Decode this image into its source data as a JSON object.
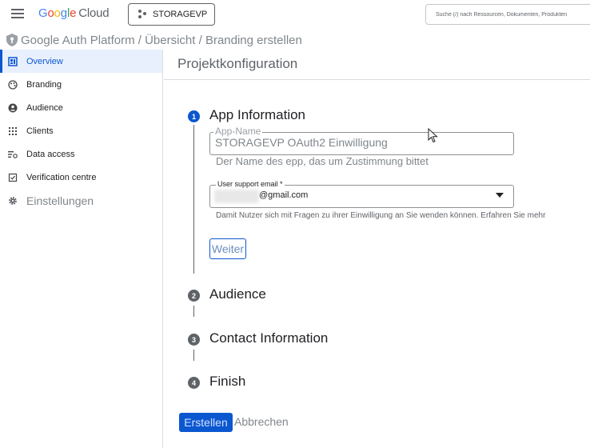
{
  "topbar": {
    "logo_letters": [
      "G",
      "o",
      "o",
      "g",
      "l",
      "e"
    ],
    "logo_suffix": "Cloud",
    "project_name": "STORAGEVP",
    "search_placeholder": "Suche (/) nach Ressourcen, Dokumenten, Produkten"
  },
  "breadcrumb": {
    "text": "Google Auth Platform / Übersicht / Branding erstellen"
  },
  "sidebar": {
    "items": [
      {
        "label": "Overview",
        "icon": "dashboard-icon",
        "active": true
      },
      {
        "label": "Branding",
        "icon": "palette-icon"
      },
      {
        "label": "Audience",
        "icon": "person-icon"
      },
      {
        "label": "Clients",
        "icon": "grid-icon"
      },
      {
        "label": "Data access",
        "icon": "list-settings-icon"
      },
      {
        "label": "Verification centre",
        "icon": "checkbox-icon"
      },
      {
        "label": "Einstellungen",
        "icon": "gear-icon"
      }
    ]
  },
  "main": {
    "title": "Projektkonfiguration",
    "steps": [
      {
        "number": "1",
        "title": "App Information",
        "active": true
      },
      {
        "number": "2",
        "title": "Audience"
      },
      {
        "number": "3",
        "title": "Contact Information"
      },
      {
        "number": "4",
        "title": "Finish"
      }
    ],
    "app_name": {
      "label": "App-Name",
      "value": "STORAGEVP OAuth2 Einwilligung",
      "hint": "Der Name des epp, das um Zustimmung bittet"
    },
    "support_email": {
      "label": "User support email *",
      "value": "@gmail.com",
      "hint": "Damit Nutzer sich mit Fragen zu ihrer Einwilligung an Sie wenden können. Erfahren Sie mehr"
    },
    "next_button": "Weiter",
    "create_button": "Erstellen",
    "cancel_button": "Abbrechen"
  },
  "colors": {
    "accent": "#0b57d0",
    "active_bg": "#e8f0fe",
    "muted_text": "#80868b"
  }
}
